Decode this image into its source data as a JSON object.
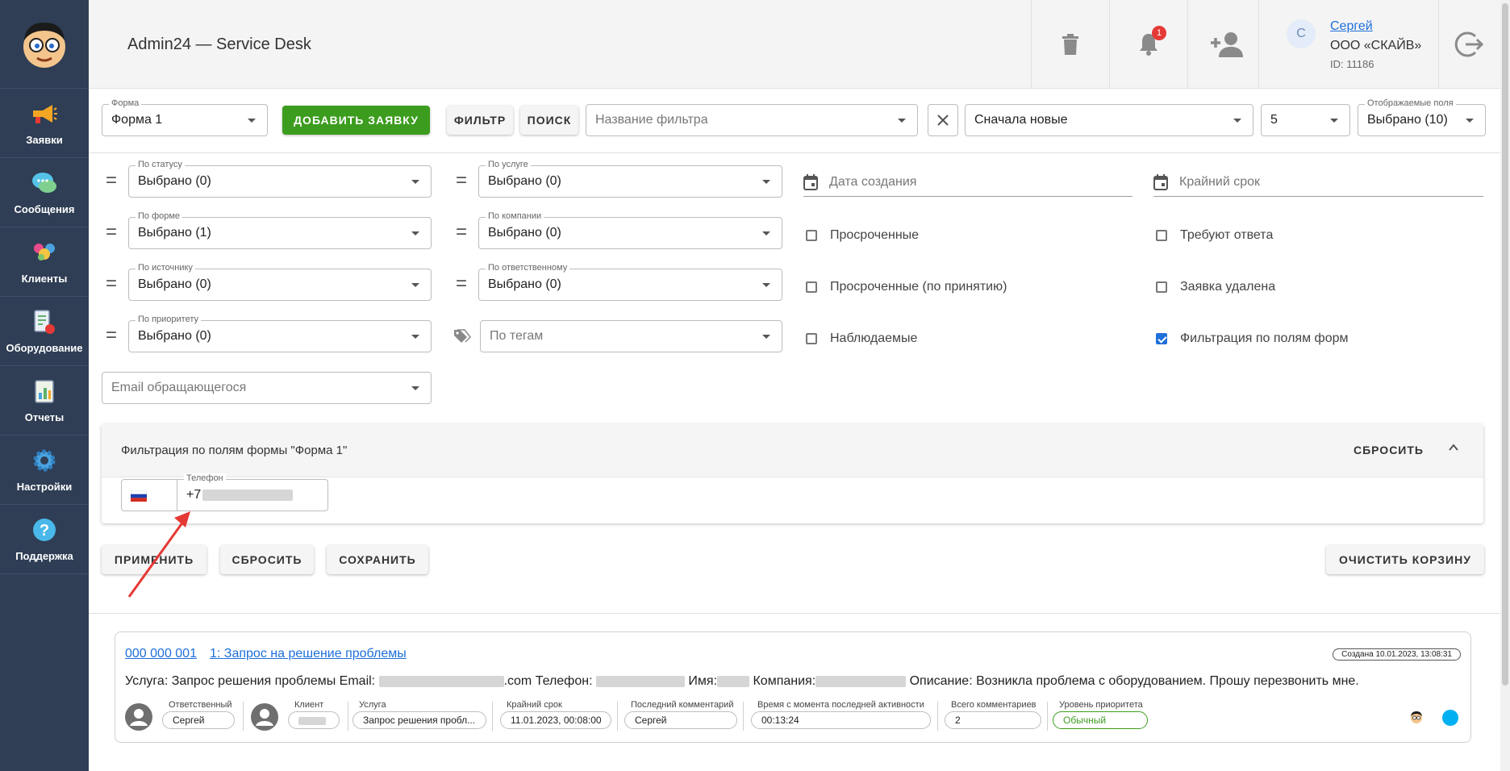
{
  "sidebar": {
    "items": [
      {
        "label": "Заявки",
        "icon": "megaphone-icon"
      },
      {
        "label": "Сообщения",
        "icon": "chat-bubbles-icon"
      },
      {
        "label": "Клиенты",
        "icon": "clients-icon"
      },
      {
        "label": "Оборудование",
        "icon": "equipment-icon"
      },
      {
        "label": "Отчеты",
        "icon": "report-icon"
      },
      {
        "label": "Настройки",
        "icon": "gear-icon"
      },
      {
        "label": "Поддержка",
        "icon": "help-icon"
      }
    ]
  },
  "header": {
    "title": "Admin24 — Service Desk",
    "notifications_count": "1",
    "user": {
      "initial": "С",
      "name": "Сергей",
      "company": "ООО «СКАЙВ»",
      "id": "ID: 11186"
    }
  },
  "toolbar": {
    "form_label": "Форма",
    "form_value": "Форма 1",
    "add_button": "ДОБАВИТЬ ЗАЯВКУ",
    "filter_button": "ФИЛЬТР",
    "search_button": "ПОИСК",
    "filter_name_placeholder": "Название фильтра",
    "sort_value": "Сначала новые",
    "per_page_value": "5",
    "displayed_fields_label": "Отображаемые поля",
    "displayed_fields_value": "Выбрано (10)"
  },
  "filters": {
    "status": {
      "label": "По статусу",
      "value": "Выбрано (0)"
    },
    "service": {
      "label": "По услуге",
      "value": "Выбрано (0)"
    },
    "form": {
      "label": "По форме",
      "value": "Выбрано (1)"
    },
    "company": {
      "label": "По компании",
      "value": "Выбрано (0)"
    },
    "source": {
      "label": "По источнику",
      "value": "Выбрано (0)"
    },
    "responsible": {
      "label": "По ответственному",
      "value": "Выбрано (0)"
    },
    "priority": {
      "label": "По приоритету",
      "value": "Выбрано (0)"
    },
    "tags_placeholder": "По тегам",
    "email_placeholder": "Email обращающегося",
    "created_date_placeholder": "Дата создания",
    "deadline_placeholder": "Крайний срок",
    "checkboxes": {
      "overdue": {
        "label": "Просроченные",
        "checked": false
      },
      "need_answer": {
        "label": "Требуют ответа",
        "checked": false
      },
      "overdue_accept": {
        "label": "Просроченные (по принятию)",
        "checked": false
      },
      "deleted": {
        "label": "Заявка удалена",
        "checked": false
      },
      "watched": {
        "label": "Наблюдаемые",
        "checked": false
      },
      "form_fields": {
        "label": "Фильтрация по полям форм",
        "checked": true
      }
    }
  },
  "form_filter_panel": {
    "title": "Фильтрация по полям формы \"Форма 1\"",
    "reset": "СБРОСИТЬ",
    "phone_label": "Телефон",
    "phone_value": "+7"
  },
  "actions": {
    "apply": "ПРИМЕНИТЬ",
    "reset": "СБРОСИТЬ",
    "save": "СОХРАНИТЬ",
    "clear_trash": "ОЧИСТИТЬ КОРЗИНУ"
  },
  "ticket": {
    "number": "000 000 001",
    "subject": "1: Запрос на решение проблемы",
    "created": "Создана 10.01.2023, 13:08:31",
    "desc_service": "Услуга: Запрос решения проблемы Email: ",
    "desc_com": ".com Телефон: ",
    "desc_name": " Имя:",
    "desc_company": " Компания:",
    "desc_text": " Описание: Возникла проблема с оборудованием. Прошу перезвонить мне.",
    "responsible_label": "Ответственный",
    "responsible": "Сергей",
    "client_label": "Клиент",
    "service_label": "Услуга",
    "service": "Запрос решения пробл...",
    "deadline_label": "Крайний срок",
    "deadline": "11.01.2023, 00:08:00",
    "last_comment_label": "Последний комментарий",
    "last_comment": "Сергей",
    "since_activity_label": "Время с момента последней активности",
    "since_activity": "00:13:24",
    "total_comments_label": "Всего комментариев",
    "total_comments": "2",
    "priority_label": "Уровень приоритета",
    "priority": "Обычный",
    "status_color": "#00b0f0"
  },
  "colors": {
    "sidebar": "#2f3e55",
    "accent_green": "#3c9c1e",
    "link": "#1e6fd9",
    "annotation_arrow": "#e53935"
  }
}
